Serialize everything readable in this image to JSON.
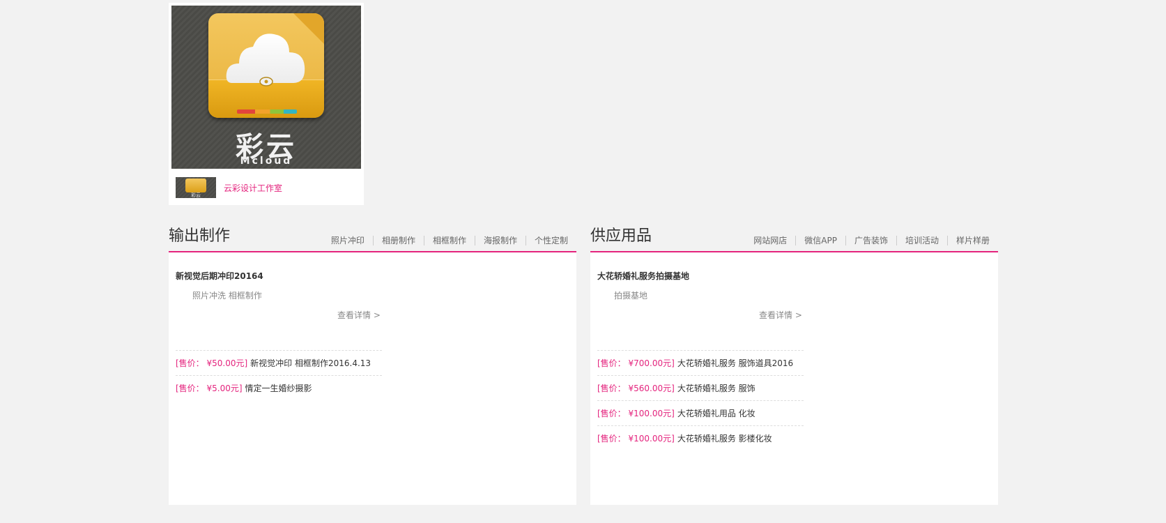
{
  "shop": {
    "logo_title": "彩云",
    "logo_subtitle": "Mcloud",
    "thumb_text": "彩云",
    "name": "云彩设计工作室"
  },
  "sections": [
    {
      "title": "输出制作",
      "nav": [
        "照片冲印",
        "相册制作",
        "相框制作",
        "海报制作",
        "个性定制"
      ],
      "feature": {
        "title": "新视觉后期冲印20164",
        "tags": "照片冲洗 相框制作",
        "more": "查看详情 >"
      },
      "products": [
        {
          "price": "[售价： ¥50.00元]",
          "name": "新视觉冲印 相框制作2016.4.13"
        },
        {
          "price": "[售价： ¥5.00元]",
          "name": "情定一生婚纱摄影"
        }
      ]
    },
    {
      "title": "供应用品",
      "nav": [
        "网站网店",
        "微信APP",
        "广告装饰",
        "培训活动",
        "样片样册"
      ],
      "feature": {
        "title": "大花轿婚礼服务拍摄基地",
        "tags": "拍摄基地",
        "more": "查看详情 >"
      },
      "products": [
        {
          "price": "[售价： ¥700.00元]",
          "name": "大花轿婚礼服务 服饰道具2016"
        },
        {
          "price": "[售价： ¥560.00元]",
          "name": "大花轿婚礼服务 服饰"
        },
        {
          "price": "[售价： ¥100.00元]",
          "name": "大花轿婚礼用品 化妆"
        },
        {
          "price": "[售价： ¥100.00元]",
          "name": "大花轿婚礼服务 影楼化妆"
        }
      ]
    }
  ],
  "colors": {
    "accent": "#e4237d",
    "background": "#f2f2f2"
  }
}
